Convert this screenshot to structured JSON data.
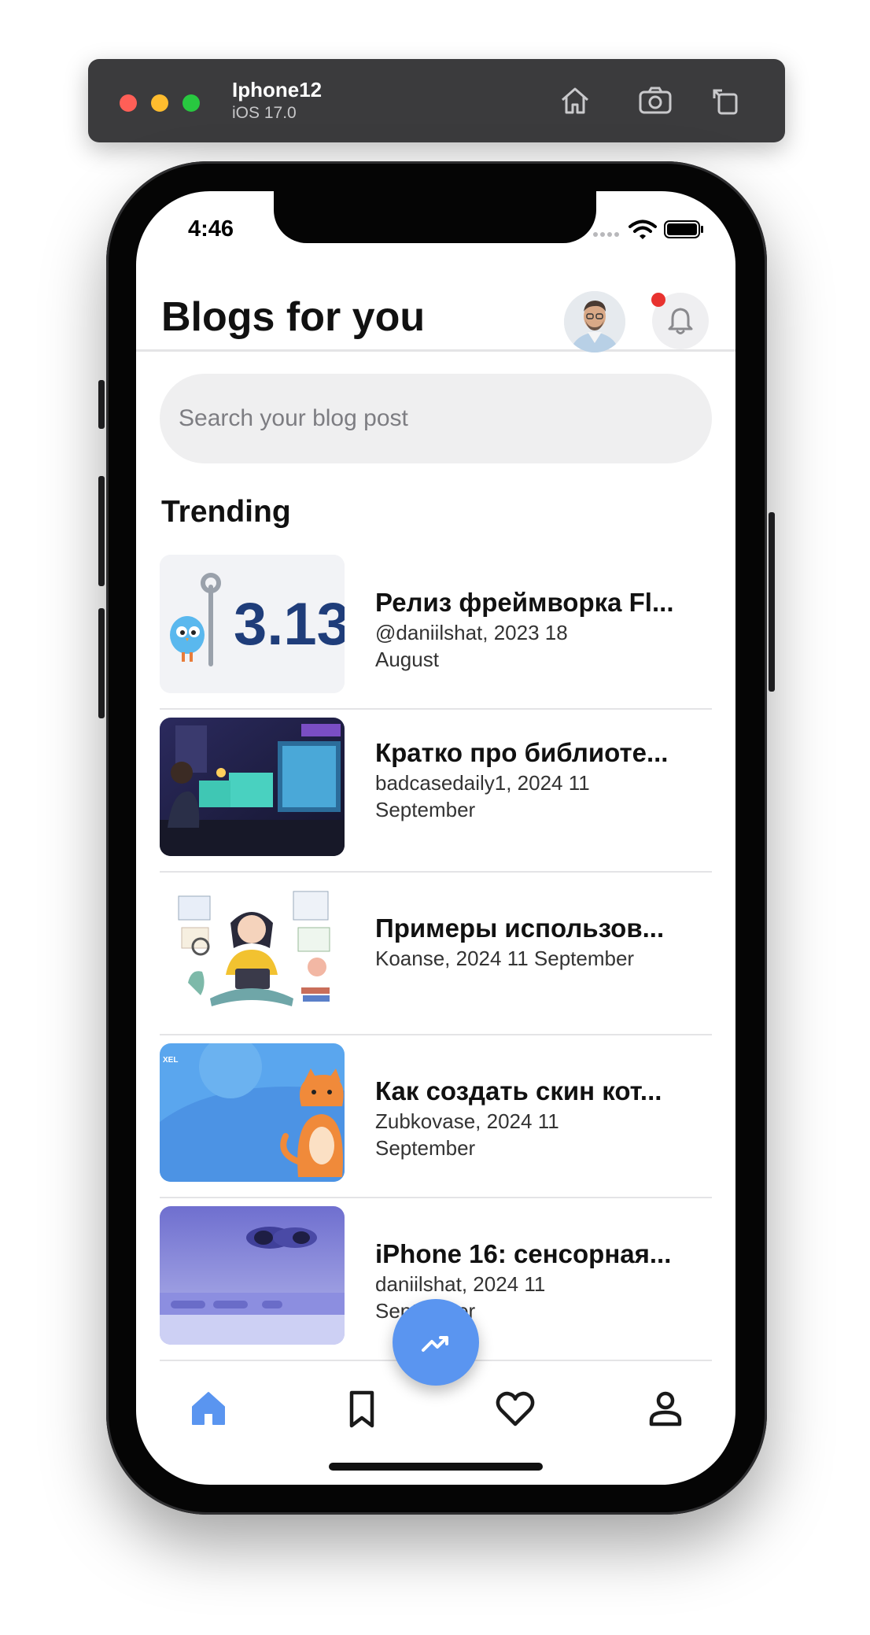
{
  "simulator": {
    "device_name": "Iphone12",
    "os_version": "iOS 17.0",
    "icons": [
      "home-icon",
      "screenshot-icon",
      "rotate-icon"
    ]
  },
  "status_bar": {
    "time": "4:46",
    "icons": [
      "signal-icon",
      "wifi-icon",
      "battery-icon"
    ]
  },
  "header": {
    "title": "Blogs for you",
    "avatar_icon": "avatar",
    "notification_icon": "bell-icon",
    "has_notification": true,
    "notification_color": "#e8322f"
  },
  "search": {
    "placeholder": "Search your blog post"
  },
  "trending": {
    "title": "Trending",
    "posts": [
      {
        "title": "Релиз фреймворка Fl...",
        "meta": "@daniilshat, 2023 18 August"
      },
      {
        "title": "Кратко про библиоте...",
        "meta": "badcasedaily1, 2024 11 September"
      },
      {
        "title": "Примеры использов...",
        "meta": "Koanse, 2024 11 September"
      },
      {
        "title": "Как создать скин кот...",
        "meta": "Zubkovase, 2024 11 September"
      },
      {
        "title": "iPhone 16: сенсорная...",
        "meta": "daniilshat, 2024 11 September"
      }
    ]
  },
  "thumbnails": {
    "post1_text": "3.13",
    "post4_text": "XEL"
  },
  "bottom_nav": {
    "items": [
      "home-icon",
      "bookmark-icon",
      "heart-icon",
      "profile-icon"
    ],
    "active": "home-icon",
    "fab_icon": "trending-up-icon",
    "accent": "#5a95f0"
  }
}
